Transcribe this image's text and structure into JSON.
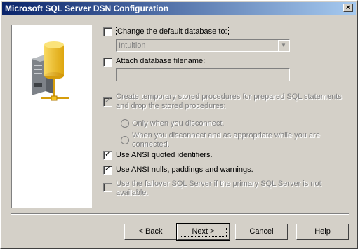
{
  "window": {
    "title": "Microsoft SQL Server DSN Configuration",
    "close_glyph": "×"
  },
  "options": {
    "change_default_db": {
      "label": "Change the default database to:",
      "checked": false
    },
    "default_db_value": "Intuition",
    "attach_db": {
      "label": "Attach database filename:",
      "checked": false
    },
    "attach_db_value": "",
    "create_temp_procs": {
      "label_line1": "Create temporary stored procedures for prepared SQL statements",
      "label_line2": "and drop the stored procedures:",
      "checked": true,
      "disabled": true
    },
    "only_when_disconnect": {
      "label": "Only when you disconnect.",
      "disabled": true
    },
    "when_disconnect_appropriate": {
      "label_line1": "When you disconnect and as appropriate while you are",
      "label_line2": "connected.",
      "disabled": true
    },
    "ansi_quoted": {
      "label": "Use ANSI quoted identifiers.",
      "checked": true
    },
    "ansi_nulls": {
      "label": "Use ANSI nulls, paddings and warnings.",
      "checked": true
    },
    "failover": {
      "label_line1": "Use the failover SQL Server if the primary SQL Server is not",
      "label_line2": "available.",
      "checked": false,
      "disabled": true
    }
  },
  "buttons": {
    "back": "< Back",
    "next": "Next >",
    "cancel": "Cancel",
    "help": "Help"
  },
  "colors": {
    "dialog_bg": "#d4d0c8",
    "title_start": "#0a246a",
    "title_end": "#a6caf0",
    "disabled_text": "#808080"
  },
  "icons": {
    "wizard_art": "database-server-icon",
    "check": "checkmark-icon"
  }
}
